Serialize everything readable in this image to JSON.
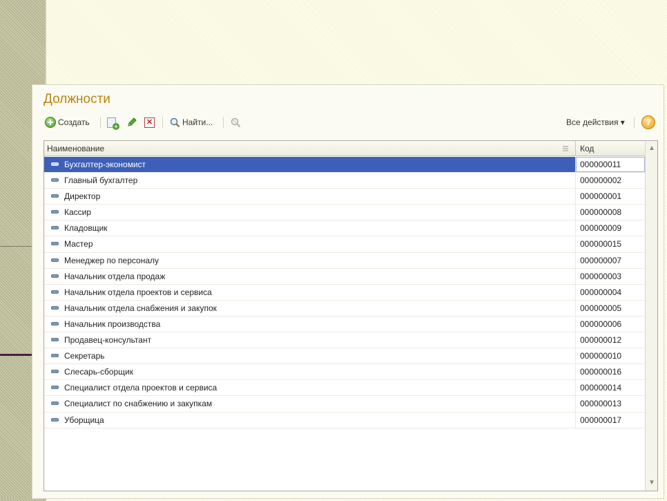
{
  "window": {
    "title": "Должности"
  },
  "toolbar": {
    "create_label": "Создать",
    "find_label": "Найти...",
    "all_actions_label": "Все действия ▾",
    "help_label": "?"
  },
  "table": {
    "columns": [
      "Наименование",
      "Код"
    ],
    "rows": [
      {
        "name": "Бухгалтер-экономист",
        "code": "000000011"
      },
      {
        "name": "Главный бухгалтер",
        "code": "000000002"
      },
      {
        "name": "Директор",
        "code": "000000001"
      },
      {
        "name": "Кассир",
        "code": "000000008"
      },
      {
        "name": "Кладовщик",
        "code": "000000009"
      },
      {
        "name": "Мастер",
        "code": "000000015"
      },
      {
        "name": "Менеджер по персоналу",
        "code": "000000007"
      },
      {
        "name": "Начальник отдела продаж",
        "code": "000000003"
      },
      {
        "name": "Начальник отдела проектов и сервиса",
        "code": "000000004"
      },
      {
        "name": "Начальник отдела снабжения и закупок",
        "code": "000000005"
      },
      {
        "name": "Начальник производства",
        "code": "000000006"
      },
      {
        "name": "Продавец-консультант",
        "code": "000000012"
      },
      {
        "name": "Секретарь",
        "code": "000000010"
      },
      {
        "name": "Слесарь-сборщик",
        "code": "000000016"
      },
      {
        "name": "Специалист отдела проектов и сервиса",
        "code": "000000014"
      },
      {
        "name": "Специалист по снабжению и закупкам",
        "code": "000000013"
      },
      {
        "name": "Уборщица",
        "code": "000000017"
      }
    ],
    "selected_index": 0
  },
  "colors": {
    "title": "#b7860b",
    "selection": "#3e5fb8"
  }
}
